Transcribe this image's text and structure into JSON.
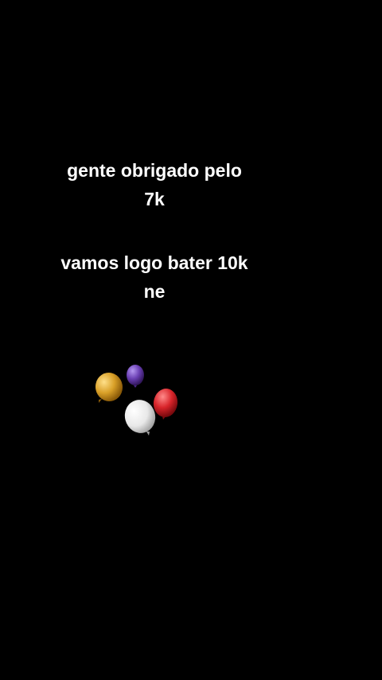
{
  "caption_1": {
    "line_1": "gente obrigado pelo",
    "line_2": "7k"
  },
  "caption_2": {
    "line_1": "vamos logo bater 10k",
    "line_2": "ne"
  },
  "sticker": {
    "icon": "balloons-icon",
    "colors": {
      "gold": "#d9a028",
      "purple": "#6a3fb3",
      "white": "#e8e8e8",
      "red": "#d8242a"
    }
  },
  "background": "#000000"
}
